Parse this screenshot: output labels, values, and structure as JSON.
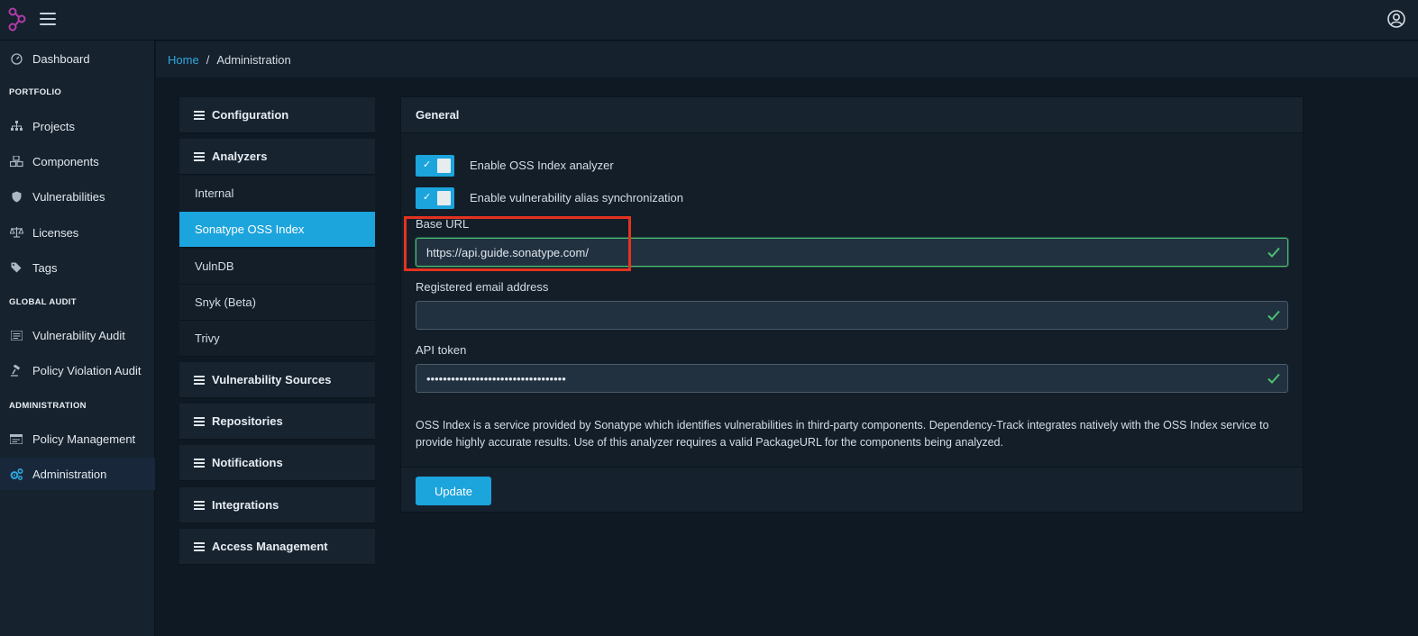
{
  "header": {
    "logo_icon": "dependency-track-logo",
    "menu_icon": "hamburger-icon",
    "user_icon": "user-circle-icon"
  },
  "sidebar": {
    "items": [
      {
        "label": "Dashboard",
        "icon": "speedometer-icon"
      },
      {
        "label": "Projects",
        "icon": "sitemap-icon"
      },
      {
        "label": "Components",
        "icon": "cubes-icon"
      },
      {
        "label": "Vulnerabilities",
        "icon": "shield-icon"
      },
      {
        "label": "Licenses",
        "icon": "balance-scale-icon"
      },
      {
        "label": "Tags",
        "icon": "tag-icon"
      },
      {
        "label": "Vulnerability Audit",
        "icon": "list-icon"
      },
      {
        "label": "Policy Violation Audit",
        "icon": "gavel-icon"
      },
      {
        "label": "Policy Management",
        "icon": "policy-icon"
      },
      {
        "label": "Administration",
        "icon": "cogs-icon"
      }
    ],
    "sections": {
      "portfolio": "PORTFOLIO",
      "global_audit": "GLOBAL AUDIT",
      "administration": "ADMINISTRATION"
    }
  },
  "breadcrumb": {
    "home": "Home",
    "separator": "/",
    "current": "Administration"
  },
  "admin_menu": {
    "configuration": "Configuration",
    "analyzers": "Analyzers",
    "analyzer_items": [
      "Internal",
      "Sonatype OSS Index",
      "VulnDB",
      "Snyk (Beta)",
      "Trivy"
    ],
    "active_item": "Sonatype OSS Index",
    "vulnerability_sources": "Vulnerability Sources",
    "repositories": "Repositories",
    "notifications": "Notifications",
    "integrations": "Integrations",
    "access_management": "Access Management"
  },
  "general": {
    "title": "General",
    "toggle_oss": {
      "label": "Enable OSS Index analyzer",
      "checked": true
    },
    "toggle_alias": {
      "label": "Enable vulnerability alias synchronization",
      "checked": true
    },
    "base_url": {
      "label": "Base URL",
      "value": "https://api.guide.sonatype.com/"
    },
    "email": {
      "label": "Registered email address",
      "value": ""
    },
    "api_token": {
      "label": "API token",
      "value": "••••••••••••••••••••••••••••••••••"
    },
    "description": "OSS Index is a service provided by Sonatype which identifies vulnerabilities in third-party components. Dependency-Track integrates natively with the OSS Index service to provide highly accurate results. Use of this analyzer requires a valid PackageURL for the components being analyzed.",
    "update_button": "Update"
  },
  "colors": {
    "accent": "#1ca4dc",
    "valid": "#4bbf73",
    "highlight": "#e5321f"
  }
}
